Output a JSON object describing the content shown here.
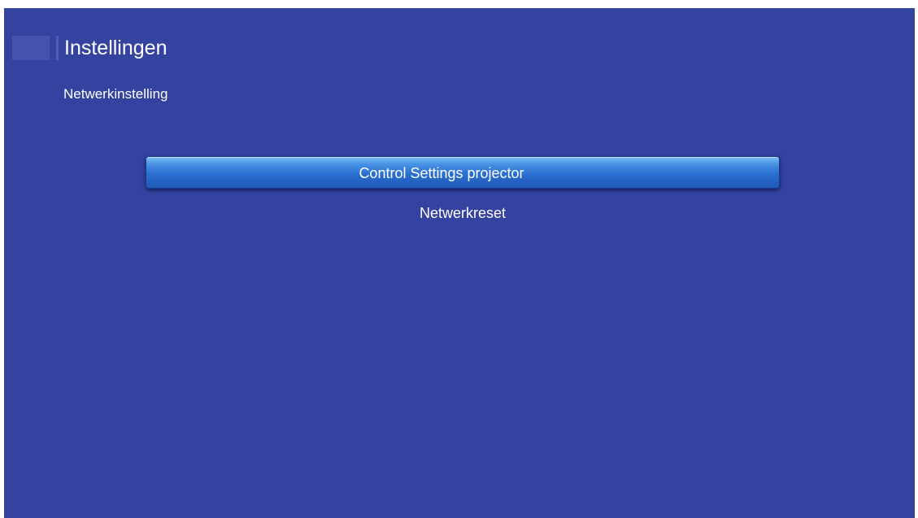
{
  "header": {
    "title": "Instellingen",
    "breadcrumb": "Netwerkinstelling"
  },
  "menu": {
    "items": [
      {
        "label": "Control Settings projector",
        "selected": true
      },
      {
        "label": "Netwerkreset",
        "selected": false
      }
    ]
  },
  "colors": {
    "background": "#3442a0",
    "selection": "#2a6fd0",
    "text": "#ffffff"
  }
}
